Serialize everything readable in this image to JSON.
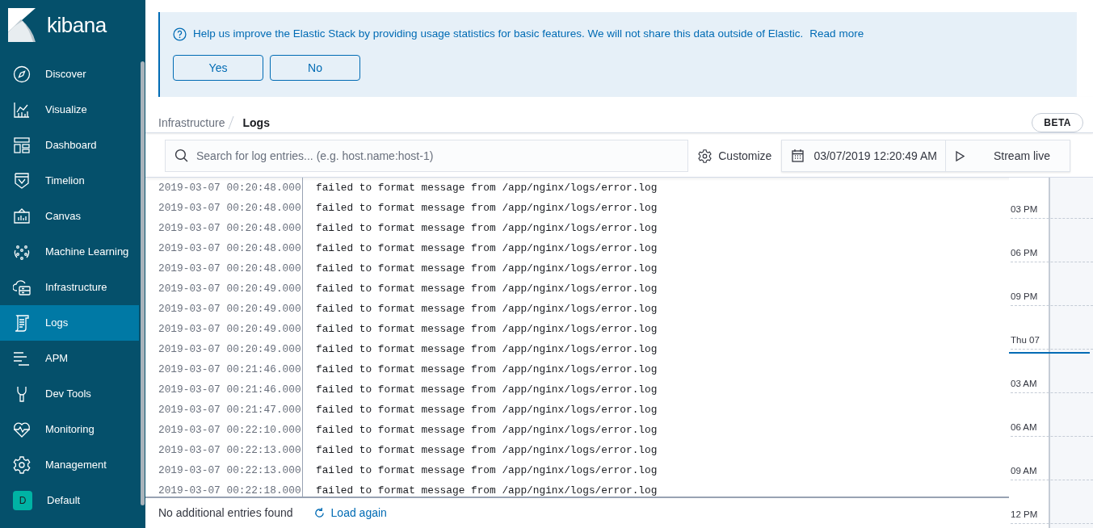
{
  "app": {
    "logo_text": "kibana"
  },
  "sidebar": {
    "items": [
      {
        "kind": "app",
        "label": "Discover",
        "selected": false
      },
      {
        "kind": "app",
        "label": "Visualize",
        "selected": false
      },
      {
        "kind": "app",
        "label": "Dashboard",
        "selected": false
      },
      {
        "kind": "app",
        "label": "Timelion",
        "selected": false
      },
      {
        "kind": "app",
        "label": "Canvas",
        "selected": false
      },
      {
        "kind": "app",
        "label": "Machine Learning",
        "selected": false
      },
      {
        "kind": "app",
        "label": "Infrastructure",
        "selected": false
      },
      {
        "kind": "app",
        "label": "Logs",
        "selected": true
      },
      {
        "kind": "app",
        "label": "APM",
        "selected": false
      },
      {
        "kind": "app",
        "label": "Dev Tools",
        "selected": false
      },
      {
        "kind": "app",
        "label": "Monitoring",
        "selected": false
      },
      {
        "kind": "app",
        "label": "Management",
        "selected": false
      },
      {
        "kind": "space",
        "label": "Default",
        "avatar": "D",
        "selected": false
      }
    ]
  },
  "callout": {
    "text": "Help us improve the Elastic Stack by providing usage statistics for basic features. We will not share this data outside of Elastic.",
    "link": "Read more",
    "buttons": [
      "Yes",
      "No"
    ]
  },
  "breadcrumbs": [
    "Infrastructure",
    "Logs"
  ],
  "badge": "BETA",
  "toolbar": {
    "search": {
      "placeholder": "Search for log entries... (e.g. host.name:host-1)"
    },
    "customize": "Customize",
    "date": "03/07/2019 12:20:49 AM",
    "stream": "Stream live"
  },
  "log_entries": [
    {
      "timestamp": "2019-03-07 00:20:48.000",
      "message": "failed to format message from /app/nginx/logs/error.log"
    },
    {
      "timestamp": "2019-03-07 00:20:48.000",
      "message": "failed to format message from /app/nginx/logs/error.log"
    },
    {
      "timestamp": "2019-03-07 00:20:48.000",
      "message": "failed to format message from /app/nginx/logs/error.log"
    },
    {
      "timestamp": "2019-03-07 00:20:48.000",
      "message": "failed to format message from /app/nginx/logs/error.log"
    },
    {
      "timestamp": "2019-03-07 00:20:48.000",
      "message": "failed to format message from /app/nginx/logs/error.log"
    },
    {
      "timestamp": "2019-03-07 00:20:49.000",
      "message": "failed to format message from /app/nginx/logs/error.log"
    },
    {
      "timestamp": "2019-03-07 00:20:49.000",
      "message": "failed to format message from /app/nginx/logs/error.log"
    },
    {
      "timestamp": "2019-03-07 00:20:49.000",
      "message": "failed to format message from /app/nginx/logs/error.log"
    },
    {
      "timestamp": "2019-03-07 00:20:49.000",
      "message": "failed to format message from /app/nginx/logs/error.log"
    },
    {
      "timestamp": "2019-03-07 00:21:46.000",
      "message": "failed to format message from /app/nginx/logs/error.log"
    },
    {
      "timestamp": "2019-03-07 00:21:46.000",
      "message": "failed to format message from /app/nginx/logs/error.log"
    },
    {
      "timestamp": "2019-03-07 00:21:47.000",
      "message": "failed to format message from /app/nginx/logs/error.log"
    },
    {
      "timestamp": "2019-03-07 00:22:10.000",
      "message": "failed to format message from /app/nginx/logs/error.log"
    },
    {
      "timestamp": "2019-03-07 00:22:13.000",
      "message": "failed to format message from /app/nginx/logs/error.log"
    },
    {
      "timestamp": "2019-03-07 00:22:13.000",
      "message": "failed to format message from /app/nginx/logs/error.log"
    },
    {
      "timestamp": "2019-03-07 00:22:18.000",
      "message": "failed to format message from /app/nginx/logs/error.log"
    }
  ],
  "footer": {
    "status": "No additional entries found",
    "link": "Load again"
  },
  "timeline": {
    "ticks": [
      "03 PM",
      "06 PM",
      "09 PM",
      "Thu 07",
      "03 AM",
      "06 AM",
      "09 AM",
      "12 PM"
    ]
  }
}
